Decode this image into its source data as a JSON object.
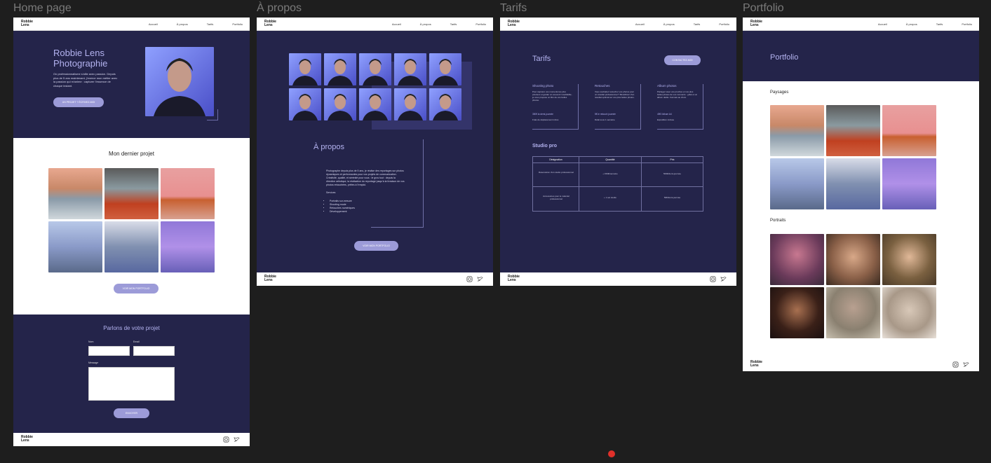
{
  "frames": {
    "home": "Home page",
    "apropos": "À propos",
    "tarifs": "Tarifs",
    "portfolio": "Portfolio"
  },
  "brand": {
    "line1": "Robbie",
    "line2": "Lens"
  },
  "nav": {
    "accueil": "Accueil",
    "apropos": "À propos",
    "tarifs": "Tarifs",
    "portfolio": "Portfolio"
  },
  "home": {
    "hero_title1": "Robbie Lens",
    "hero_title2": "Photographie",
    "hero_text": "Où professionnalisme s'allie avec passion. Depuis plus de 5 ans maintenant, j'exerce mon métier avec la passion qui m'anime : capturer l'essence de chaque instant.",
    "hero_button": "UN PROJET ? ÉCRIVEZ-MOI",
    "project_title": "Mon dernier projet",
    "portfolio_button": "VOIR MON PORTFOLIO",
    "contact_title": "Parlons de votre projet",
    "label_nom": "Nom",
    "label_email": "Email",
    "label_message": "Message",
    "send_button": "ENVOYER"
  },
  "apropos": {
    "title": "À propos",
    "text": "Photographe depuis plus de 5 ans, je réalise des reportages sur photos dynamiques et performantes pour vos projets de communication. Créativité, qualité, et sérénité pour vous : le gros tout : depuis la direction artistique, la réalisation du reportage jusqu'à la livraison de vos photos retouchées, prêtes à l'emploi.",
    "services_label": "Services",
    "services": [
      "Portraits sur-mesure",
      "Shooting mode",
      "Retouches numériques",
      "Développement"
    ],
    "button": "VOIR MON PORTFOLIO"
  },
  "tarifs": {
    "title": "Tarifs",
    "contact_button": "CONTACTEZ-MOI",
    "cols": [
      {
        "title": "Shooting photo",
        "text": "Pour capturer vos moments les plus précieux et garder un souvenir inoubliable, je vous propose un film de vos belles photos.",
        "price": "350€ la demi-journée",
        "note": "Frais de déplacement inclus"
      },
      {
        "title": "Retouches",
        "text": "Vous souhaitez retoucher vos photos pour un résultat professionnel ? Bénéficiez d'un résultat optimal sur vos plus belles photos.",
        "price": "5€ le retouch journée",
        "note": "Délai sous 1 semaine"
      },
      {
        "title": "Album photos",
        "text": "Partagez avec vos proches et vos plus belles photos de vos moments : grâce à un album dédié. Formats au choix.",
        "price": "45€ l'album A4",
        "note": "Expédition incluse"
      }
    ],
    "studio_title": "Studio pro",
    "table_headers": [
      "Désignation",
      "Quantité",
      "Prix"
    ],
    "table_rows": [
      [
        "Réservation d'un studio professionnel",
        "+ 150€/semaine",
        "500€/demi-journée"
      ],
      [
        "Accessoires pour le matériel professionnel",
        "+ 1 set studio",
        "50€/demi-journée"
      ]
    ]
  },
  "portfolio": {
    "title": "Portfolio",
    "paysages": "Paysages",
    "portraits": "Portraits"
  },
  "colors": {
    "navy": "#24244a",
    "accent": "#9c9bd8",
    "red_dot": "#e0302a"
  },
  "icons": [
    "instagram-icon",
    "twitter-icon"
  ]
}
